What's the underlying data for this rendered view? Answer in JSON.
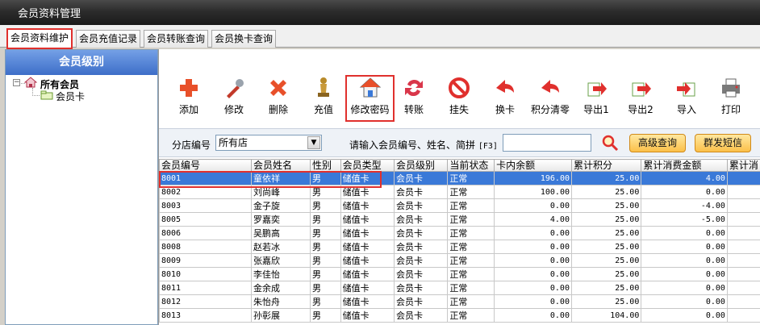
{
  "window": {
    "title": "会员资料管理"
  },
  "tabs": [
    {
      "label": "会员资料维护",
      "active": true
    },
    {
      "label": "会员充值记录"
    },
    {
      "label": "会员转账查询"
    },
    {
      "label": "会员换卡查询"
    }
  ],
  "left_panel": {
    "header": "会员级别",
    "tree": {
      "root_label": "所有会员",
      "child_label": "会员卡"
    }
  },
  "toolbar": {
    "buttons": [
      {
        "label": "添加",
        "icon": "add-icon"
      },
      {
        "label": "修改",
        "icon": "edit-icon"
      },
      {
        "label": "删除",
        "icon": "delete-icon"
      },
      {
        "label": "充值",
        "icon": "recharge-icon"
      },
      {
        "label": "修改密码",
        "icon": "password-icon"
      },
      {
        "label": "转账",
        "icon": "transfer-icon"
      },
      {
        "label": "挂失",
        "icon": "report-loss-icon"
      },
      {
        "label": "换卡",
        "icon": "change-card-icon"
      },
      {
        "label": "积分清零",
        "icon": "clear-points-icon"
      },
      {
        "label": "导出1",
        "icon": "export-icon"
      },
      {
        "label": "导出2",
        "icon": "export-icon"
      },
      {
        "label": "导入",
        "icon": "import-icon"
      },
      {
        "label": "打印",
        "icon": "print-icon"
      }
    ]
  },
  "filter": {
    "store_label": "分店编号",
    "store_value": "所有店",
    "search_label": "请输入会员编号、姓名、简拼",
    "search_hotkey": "[F3]",
    "search_value": "",
    "advanced_query": "高级查询",
    "group_sms": "群发短信"
  },
  "grid": {
    "columns": [
      "会员编号",
      "会员姓名",
      "性别",
      "会员类型",
      "会员级别",
      "当前状态",
      "卡内余额",
      "累计积分",
      "累计消费金额",
      "累计消"
    ],
    "rows": [
      [
        "8001",
        "童依祥",
        "男",
        "储值卡",
        "会员卡",
        "正常",
        "196.00",
        "25.00",
        "4.00",
        ""
      ],
      [
        "8002",
        "刘尚峰",
        "男",
        "储值卡",
        "会员卡",
        "正常",
        "100.00",
        "25.00",
        "0.00",
        ""
      ],
      [
        "8003",
        "金子旋",
        "男",
        "储值卡",
        "会员卡",
        "正常",
        "0.00",
        "25.00",
        "-4.00",
        ""
      ],
      [
        "8005",
        "罗嘉奕",
        "男",
        "储值卡",
        "会员卡",
        "正常",
        "4.00",
        "25.00",
        "-5.00",
        ""
      ],
      [
        "8006",
        "吴鹏高",
        "男",
        "储值卡",
        "会员卡",
        "正常",
        "0.00",
        "25.00",
        "0.00",
        ""
      ],
      [
        "8008",
        "赵若冰",
        "男",
        "储值卡",
        "会员卡",
        "正常",
        "0.00",
        "25.00",
        "0.00",
        ""
      ],
      [
        "8009",
        "张嘉欣",
        "男",
        "储值卡",
        "会员卡",
        "正常",
        "0.00",
        "25.00",
        "0.00",
        ""
      ],
      [
        "8010",
        "李佳怡",
        "男",
        "储值卡",
        "会员卡",
        "正常",
        "0.00",
        "25.00",
        "0.00",
        ""
      ],
      [
        "8011",
        "金余成",
        "男",
        "储值卡",
        "会员卡",
        "正常",
        "0.00",
        "25.00",
        "0.00",
        ""
      ],
      [
        "8012",
        "朱怡舟",
        "男",
        "储值卡",
        "会员卡",
        "正常",
        "0.00",
        "25.00",
        "0.00",
        ""
      ],
      [
        "8013",
        "孙彰展",
        "男",
        "储值卡",
        "会员卡",
        "正常",
        "0.00",
        "104.00",
        "0.00",
        ""
      ]
    ],
    "selected_row": 0
  },
  "colors": {
    "highlight": "#e0302d",
    "selection": "#3a79d8",
    "header_blue": "#3d6ec8"
  }
}
